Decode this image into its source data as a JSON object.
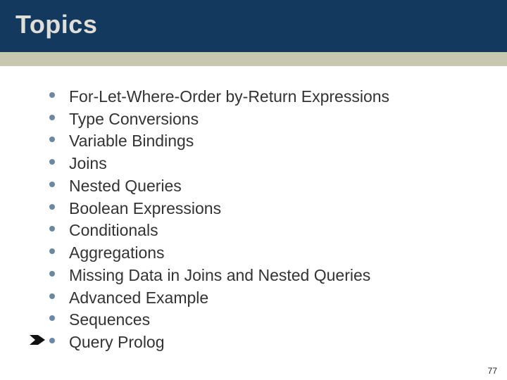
{
  "title": "Topics",
  "bullets": {
    "b0": "For-Let-Where-Order by-Return Expressions",
    "b1": "Type Conversions",
    "b2": "Variable Bindings",
    "b3": "Joins",
    "b4": "Nested Queries",
    "b5": "Boolean Expressions",
    "b6": "Conditionals",
    "b7": "Aggregations",
    "b8": "Missing Data in Joins and Nested Queries",
    "b9": "Advanced Example",
    "b10": "Sequences",
    "b11": "Query Prolog"
  },
  "page_number": "77"
}
